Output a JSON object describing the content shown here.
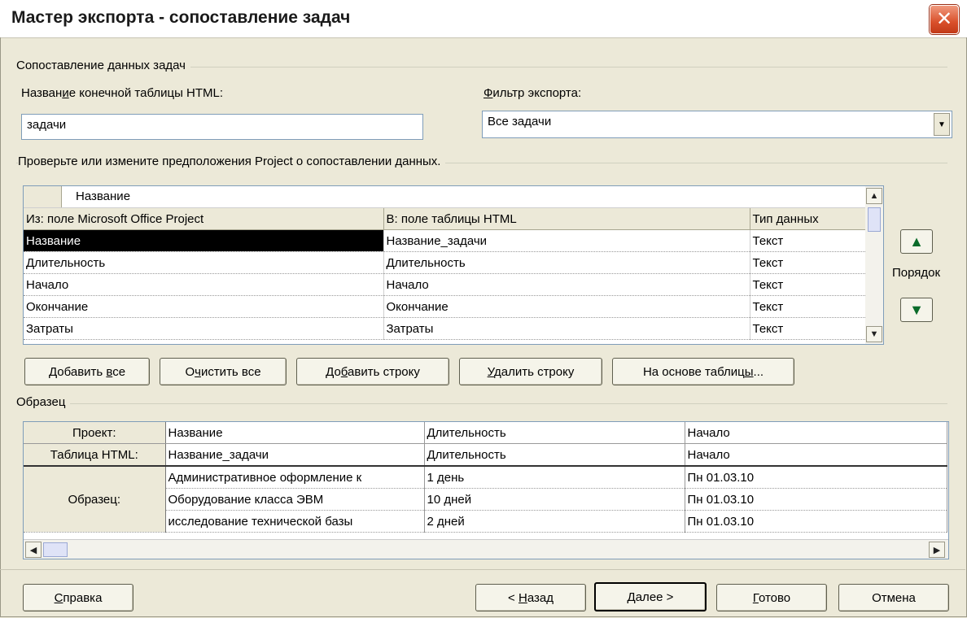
{
  "window": {
    "title": "Мастер экспорта - сопоставление задач",
    "close_icon": "close-icon"
  },
  "group_task_mapping": {
    "label": "Сопоставление данных задач"
  },
  "dest_table": {
    "label": "Название конечной таблицы HTML:",
    "value": "задачи"
  },
  "export_filter": {
    "label": "Фильтр экспорта:",
    "value": "Все задачи"
  },
  "mapping_hint": "Проверьте или измените предположения Project о сопоставлении данных.",
  "mapping": {
    "editor_value": "Название",
    "headers": [
      "Из: поле Microsoft Office Project",
      "В:  поле таблицы HTML",
      "Тип данных"
    ],
    "rows": [
      [
        "Название",
        "Название_задачи",
        "Текст"
      ],
      [
        "Длительность",
        "Длительность",
        "Текст"
      ],
      [
        "Начало",
        "Начало",
        "Текст"
      ],
      [
        "Окончание",
        "Окончание",
        "Текст"
      ],
      [
        "Затраты",
        "Затраты",
        "Текст"
      ]
    ]
  },
  "order": {
    "label": "Порядок",
    "up_icon": "arrow-up-icon",
    "down_icon": "arrow-down-icon"
  },
  "mapping_buttons": {
    "add_all": "Добавить все",
    "clear_all": "Очистить все",
    "add_row": "Добавить строку",
    "delete_row": "Удалить строку",
    "base_on_table": "На основе таблицы..."
  },
  "sample": {
    "label": "Образец",
    "row_labels": [
      "Проект:",
      "Таблица HTML:",
      "Образец:"
    ],
    "project_fields": [
      "Название",
      "Длительность",
      "Начало"
    ],
    "html_fields": [
      "Название_задачи",
      "Длительность",
      "Начало"
    ],
    "rows": [
      [
        "Административное оформление к",
        "1 день",
        "Пн 01.03.10"
      ],
      [
        "Оборудование класса ЭВМ",
        "10 дней",
        "Пн 01.03.10"
      ],
      [
        "исследование технической базы",
        "2 дней",
        "Пн 01.03.10"
      ]
    ]
  },
  "footer": {
    "help": "Справка",
    "back": "< Назад",
    "next": "Далее >",
    "finish": "Готово",
    "cancel": "Отмена"
  }
}
